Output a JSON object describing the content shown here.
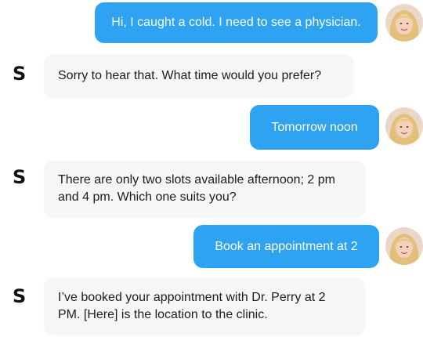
{
  "messages": [
    {
      "sender": "user",
      "text": "Hi, I caught a cold. I need to see a physician."
    },
    {
      "sender": "bot",
      "text": "Sorry to hear that. What time would you prefer?"
    },
    {
      "sender": "user",
      "text": "Tomorrow noon"
    },
    {
      "sender": "bot",
      "text": "There are only two slots available afternoon; 2 pm and 4 pm. Which one suits you?"
    },
    {
      "sender": "user",
      "text": "Book an appointment at 2"
    },
    {
      "sender": "bot",
      "text": "I’ve booked your appointment with Dr. Perry at 2 PM. [Here] is the location to the clinic."
    }
  ],
  "bot": {
    "initial": "S"
  },
  "colors": {
    "user_bubble": "#2ea3f2",
    "bot_bubble": "#f4f6f8"
  }
}
